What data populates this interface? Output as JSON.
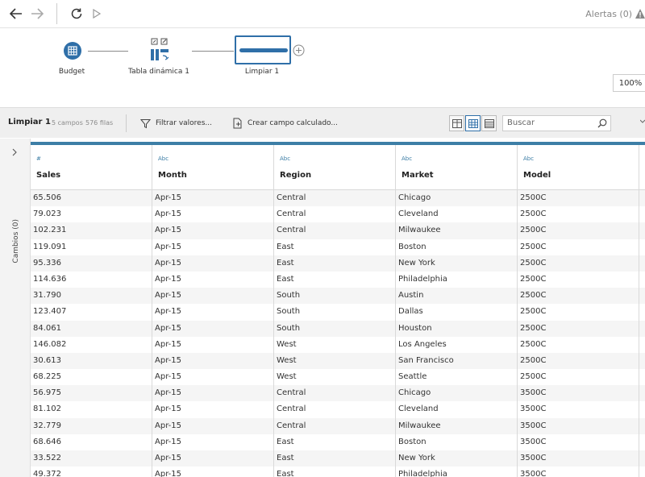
{
  "toolbar": {
    "alerts_label": "Alertas (0)"
  },
  "flow": {
    "nodes": [
      {
        "label": "Budget"
      },
      {
        "label": "Tabla dinámica 1"
      },
      {
        "label": "Limpiar 1"
      }
    ],
    "zoom": "100%"
  },
  "step": {
    "title": "Limpiar 1",
    "fields": "5 campos",
    "rows": "576 filas",
    "filter_label": "Filtrar valores...",
    "calc_label": "Crear campo calculado...",
    "search_placeholder": "Buscar"
  },
  "side": {
    "changes_label": "Cambios (0)"
  },
  "colors": {
    "accent": "#3d7ea6",
    "node_blue": "#2f6fa8"
  },
  "grid": {
    "columns": [
      {
        "type": "#",
        "name": "Sales"
      },
      {
        "type": "Abc",
        "name": "Month"
      },
      {
        "type": "Abc",
        "name": "Region"
      },
      {
        "type": "Abc",
        "name": "Market"
      },
      {
        "type": "Abc",
        "name": "Model"
      }
    ],
    "rows": [
      [
        "65.506",
        "Apr-15",
        "Central",
        "Chicago",
        "2500C"
      ],
      [
        "79.023",
        "Apr-15",
        "Central",
        "Cleveland",
        "2500C"
      ],
      [
        "102.231",
        "Apr-15",
        "Central",
        "Milwaukee",
        "2500C"
      ],
      [
        "119.091",
        "Apr-15",
        "East",
        "Boston",
        "2500C"
      ],
      [
        "95.336",
        "Apr-15",
        "East",
        "New York",
        "2500C"
      ],
      [
        "114.636",
        "Apr-15",
        "East",
        "Philadelphia",
        "2500C"
      ],
      [
        "31.790",
        "Apr-15",
        "South",
        "Austin",
        "2500C"
      ],
      [
        "123.407",
        "Apr-15",
        "South",
        "Dallas",
        "2500C"
      ],
      [
        "84.061",
        "Apr-15",
        "South",
        "Houston",
        "2500C"
      ],
      [
        "146.082",
        "Apr-15",
        "West",
        "Los Angeles",
        "2500C"
      ],
      [
        "30.613",
        "Apr-15",
        "West",
        "San Francisco",
        "2500C"
      ],
      [
        "68.225",
        "Apr-15",
        "West",
        "Seattle",
        "2500C"
      ],
      [
        "56.975",
        "Apr-15",
        "Central",
        "Chicago",
        "3500C"
      ],
      [
        "81.102",
        "Apr-15",
        "Central",
        "Cleveland",
        "3500C"
      ],
      [
        "32.779",
        "Apr-15",
        "Central",
        "Milwaukee",
        "3500C"
      ],
      [
        "68.646",
        "Apr-15",
        "East",
        "Boston",
        "3500C"
      ],
      [
        "33.522",
        "Apr-15",
        "East",
        "New York",
        "3500C"
      ],
      [
        "49.372",
        "Apr-15",
        "East",
        "Philadelphia",
        "3500C"
      ]
    ]
  }
}
